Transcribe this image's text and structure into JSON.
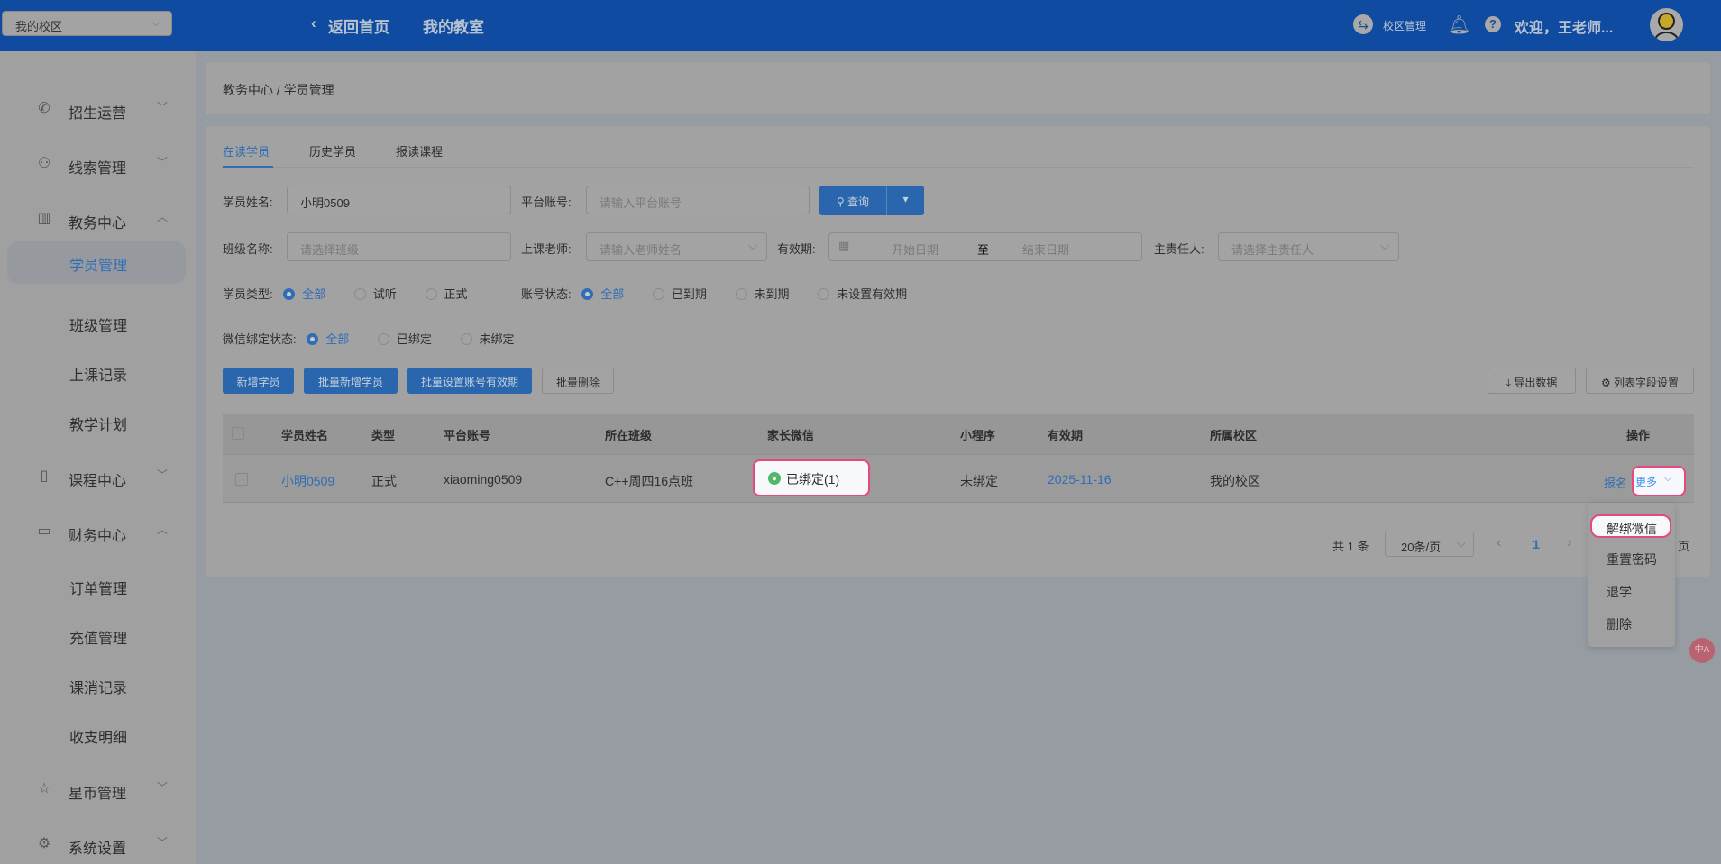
{
  "header": {
    "campus_select": "我的校区",
    "back_home": "返回首页",
    "my_classroom": "我的教室",
    "campus_manage": "校区管理",
    "welcome": "欢迎，王老师..."
  },
  "sidebar": {
    "items": [
      {
        "label": "招生运营",
        "icon": "phone-icon"
      },
      {
        "label": "线索管理",
        "icon": "user-icon"
      },
      {
        "label": "教务中心",
        "icon": "building-icon"
      },
      {
        "label": "学员管理"
      },
      {
        "label": "班级管理"
      },
      {
        "label": "上课记录"
      },
      {
        "label": "教学计划"
      },
      {
        "label": "课程中心",
        "icon": "book-icon"
      },
      {
        "label": "财务中心",
        "icon": "wallet-icon"
      },
      {
        "label": "订单管理"
      },
      {
        "label": "充值管理"
      },
      {
        "label": "课消记录"
      },
      {
        "label": "收支明细"
      },
      {
        "label": "星币管理",
        "icon": "star-icon"
      },
      {
        "label": "系统设置",
        "icon": "gear-icon"
      }
    ]
  },
  "breadcrumb": "教务中心 / 学员管理",
  "tabs": [
    "在读学员",
    "历史学员",
    "报读课程"
  ],
  "filters": {
    "student_name_label": "学员姓名:",
    "student_name_value": "小明0509",
    "platform_account_label": "平台账号:",
    "platform_account_placeholder": "请输入平台账号",
    "query": "查询",
    "class_label": "班级名称:",
    "class_placeholder": "请选择班级",
    "teacher_label": "上课老师:",
    "teacher_placeholder": "请输入老师姓名",
    "validity_label": "有效期:",
    "start_placeholder": "开始日期",
    "range_sep": "至",
    "end_placeholder": "结束日期",
    "owner_label": "主责任人:",
    "owner_placeholder": "请选择主责任人",
    "type_label": "学员类型:",
    "type_options": [
      "全部",
      "试听",
      "正式"
    ],
    "account_label": "账号状态:",
    "account_options": [
      "全部",
      "已到期",
      "未到期",
      "未设置有效期"
    ],
    "wechat_label": "微信绑定状态:",
    "wechat_options": [
      "全部",
      "已绑定",
      "未绑定"
    ]
  },
  "actions": {
    "add": "新增学员",
    "batch_add": "批量新增学员",
    "batch_validity": "批量设置账号有效期",
    "batch_delete": "批量删除",
    "export": "导出数据",
    "columns": "列表字段设置"
  },
  "table": {
    "headers": [
      "学员姓名",
      "类型",
      "平台账号",
      "所在班级",
      "家长微信",
      "小程序",
      "有效期",
      "所属校区",
      "操作"
    ],
    "rows": [
      {
        "name": "小明0509",
        "type": "正式",
        "account": "xiaoming0509",
        "class": "C++周四16点班",
        "wechat": "已绑定(1)",
        "miniapp": "未绑定",
        "validity": "2025-11-16",
        "campus": "我的校区",
        "enroll": "报名",
        "more": "更多"
      }
    ]
  },
  "more_menu": [
    "解绑微信",
    "重置密码",
    "退学",
    "删除"
  ],
  "pagination": {
    "total": "共 1 条",
    "page_size": "20条/页",
    "current": "1",
    "page_suffix": "页"
  }
}
